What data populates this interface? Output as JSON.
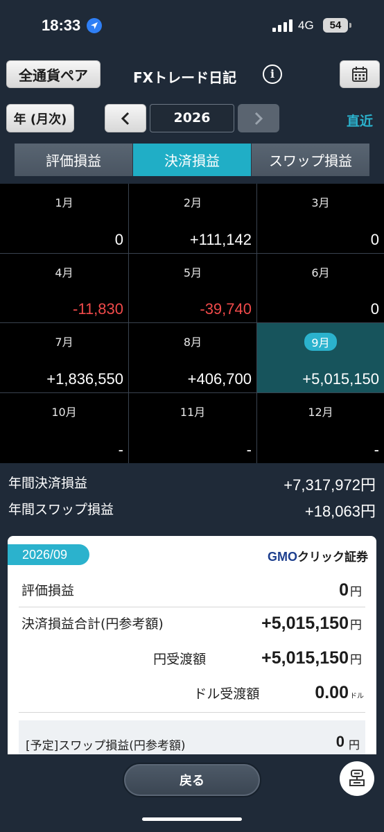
{
  "status": {
    "time": "18:33",
    "network": "4G",
    "battery": "54"
  },
  "header": {
    "pair_button": "全通貨ペア",
    "title": "FXトレード日記",
    "info_glyph": "i"
  },
  "nav": {
    "period_button": "年 (月次)",
    "year": "2026",
    "recent_link": "直近"
  },
  "tabs": [
    "評価損益",
    "決済損益",
    "スワップ損益"
  ],
  "active_tab": 1,
  "months": [
    {
      "label": "1月",
      "value": "0",
      "negative": false
    },
    {
      "label": "2月",
      "value": "+111,142",
      "negative": false
    },
    {
      "label": "3月",
      "value": "0",
      "negative": false
    },
    {
      "label": "4月",
      "value": "-11,830",
      "negative": true
    },
    {
      "label": "5月",
      "value": "-39,740",
      "negative": true
    },
    {
      "label": "6月",
      "value": "0",
      "negative": false
    },
    {
      "label": "7月",
      "value": "+1,836,550",
      "negative": false
    },
    {
      "label": "8月",
      "value": "+406,700",
      "negative": false
    },
    {
      "label": "9月",
      "value": "+5,015,150",
      "negative": false,
      "selected": true
    },
    {
      "label": "10月",
      "value": "-",
      "negative": false
    },
    {
      "label": "11月",
      "value": "-",
      "negative": false
    },
    {
      "label": "12月",
      "value": "-",
      "negative": false
    }
  ],
  "annual": {
    "settlement_label": "年間決済損益",
    "settlement_value": "+7,317,972円",
    "swap_label": "年間スワップ損益",
    "swap_value": "+18,063円"
  },
  "detail": {
    "date": "2026/09",
    "brand": "GMO",
    "brand_sub": "クリック証券",
    "valuation_label": "評価損益",
    "valuation_value": "0",
    "valuation_unit": "円",
    "settlement_total_label": "決済損益合計(円参考額)",
    "settlement_total_value": "+5,015,150",
    "settlement_total_unit": "円",
    "yen_delivery_label": "円受渡額",
    "yen_delivery_value": "+5,015,150",
    "yen_delivery_unit": "円",
    "dollar_delivery_label": "ドル受渡額",
    "dollar_delivery_value": "0.00",
    "dollar_delivery_unit": "ドル",
    "swap_label": "[予定]スワップ損益(円参考額)",
    "swap_value": "0",
    "swap_unit": "円"
  },
  "footer": {
    "back_button": "戻る"
  },
  "colors": {
    "accent": "#2bb2cd",
    "negative": "#f04a4a",
    "selected_cell": "#17545c",
    "background": "#1f2a38"
  }
}
